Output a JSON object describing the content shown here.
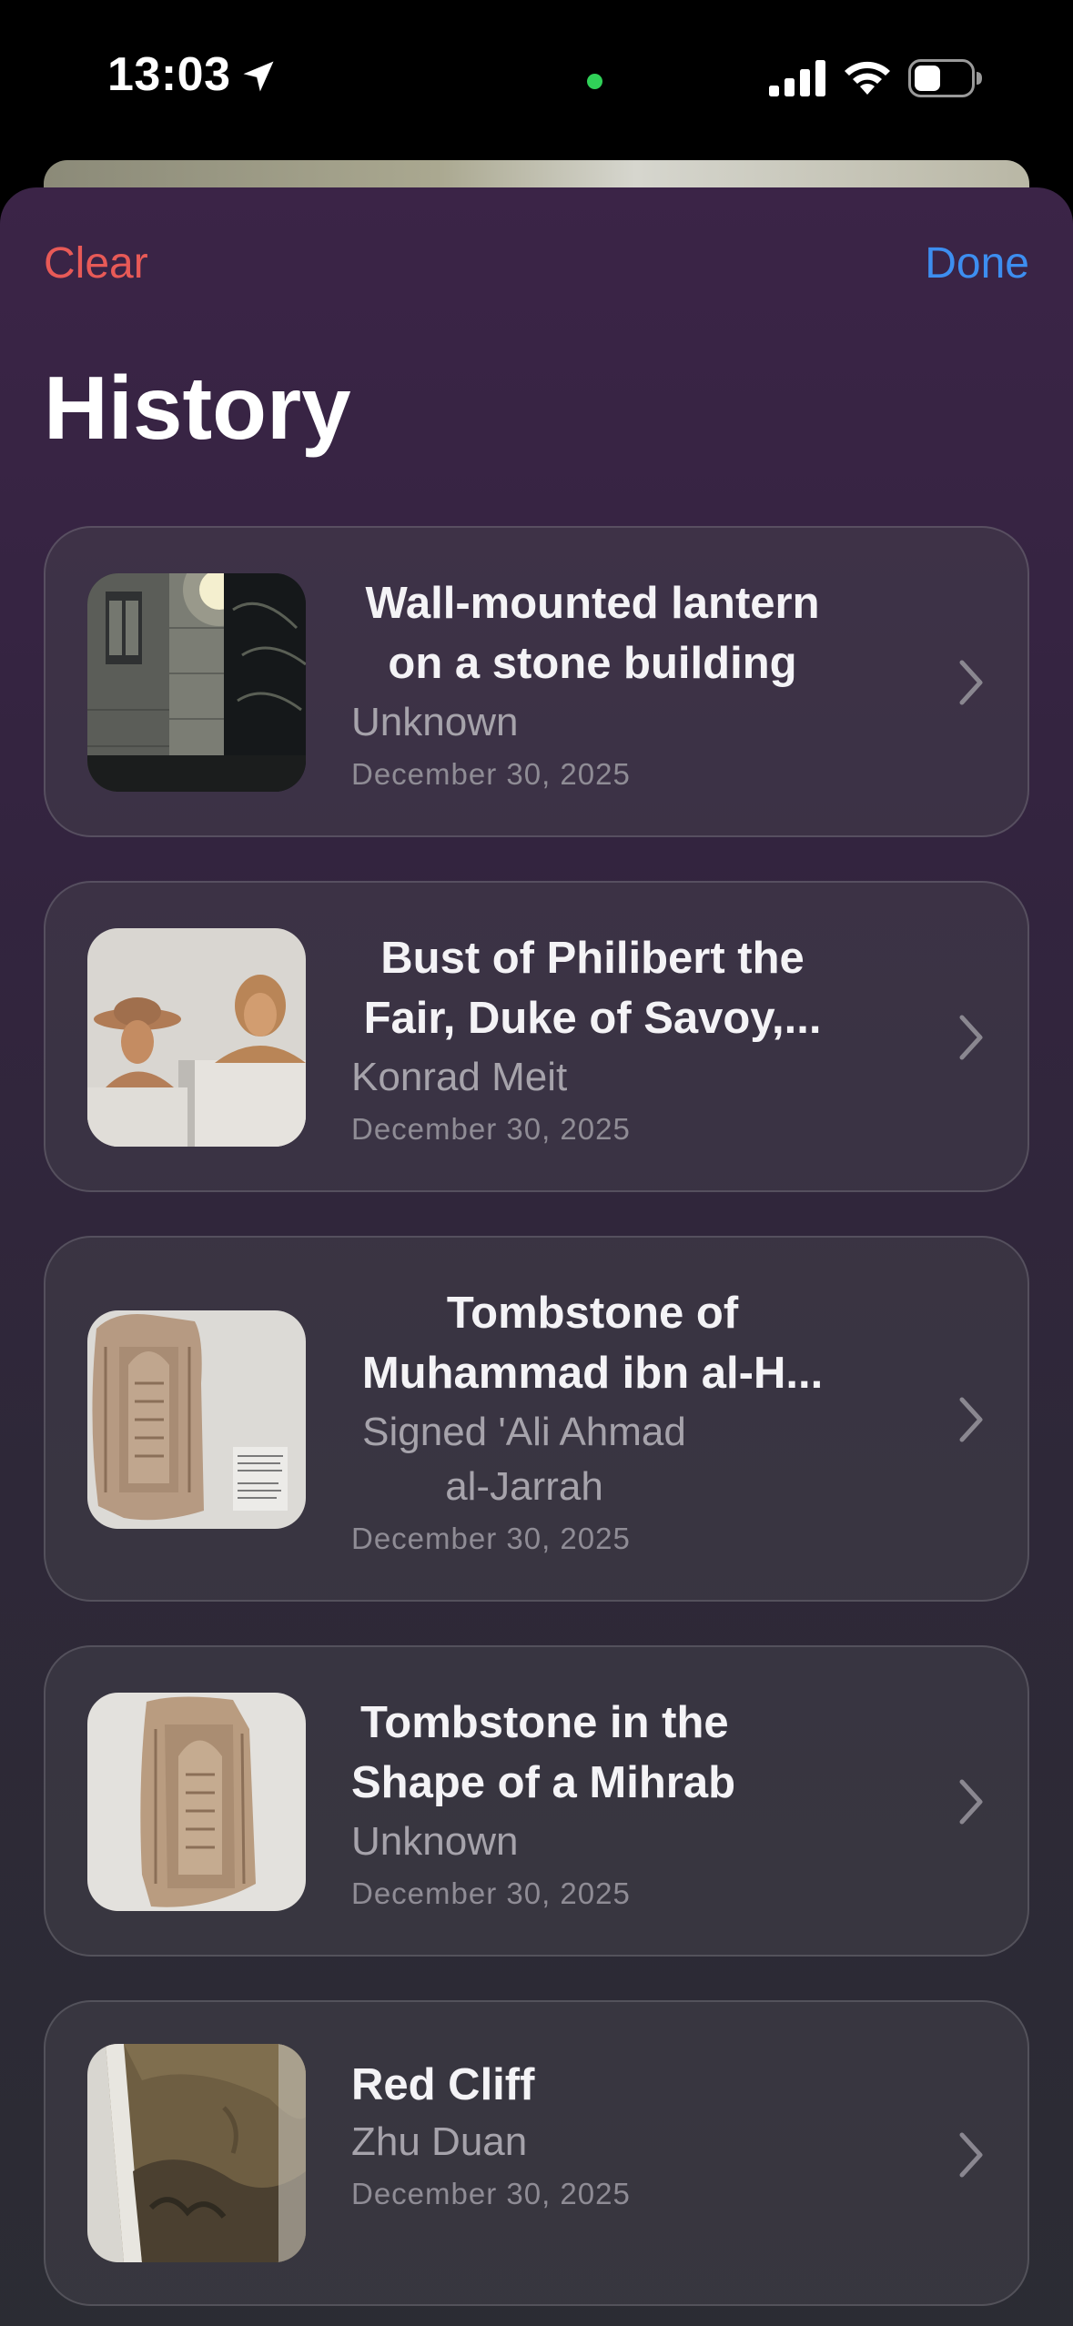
{
  "status_bar": {
    "time": "13:03",
    "location_icon": "location-arrow-icon",
    "dot_color": "#30d158",
    "signal_icon": "cellular-signal-icon",
    "wifi_icon": "wifi-icon",
    "battery_icon": "battery-icon"
  },
  "nav": {
    "clear_label": "Clear",
    "done_label": "Done",
    "clear_color": "#e85a57",
    "done_color": "#3d8ef0"
  },
  "page": {
    "title": "History"
  },
  "items": [
    {
      "title_line1": "Wall-mounted lantern",
      "title_line2": "on a stone building",
      "artist": "Unknown",
      "date": "December 30, 2025",
      "thumb_icon": "lantern-photo"
    },
    {
      "title_line1": "Bust of Philibert the",
      "title_line2": "Fair, Duke of Savoy,...",
      "artist": "Konrad Meit",
      "date": "December 30, 2025",
      "thumb_icon": "busts-photo"
    },
    {
      "title_line1": "Tombstone of",
      "title_line2": "Muhammad ibn al-H...",
      "artist_line1": "Signed 'Ali Ahmad",
      "artist_line2": "al-Jarrah",
      "date": "December 30, 2025",
      "thumb_icon": "tombstone-photo"
    },
    {
      "title_line1": "Tombstone in the",
      "title_line2": "Shape of a Mihrab",
      "artist": "Unknown",
      "date": "December 30, 2025",
      "thumb_icon": "mihrab-photo"
    },
    {
      "title_line1": "Red Cliff",
      "artist": "Zhu Duan",
      "date": "December 30, 2025",
      "thumb_icon": "landscape-painting-photo"
    }
  ],
  "chevron_icon": "chevron-right-icon"
}
